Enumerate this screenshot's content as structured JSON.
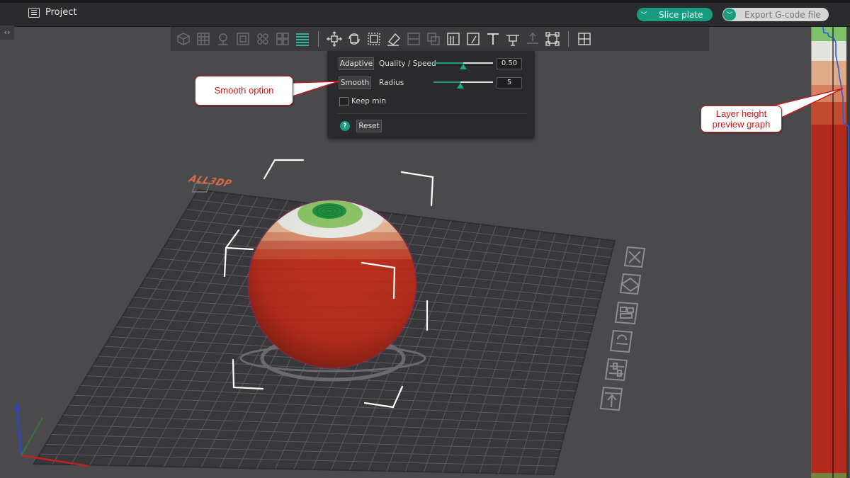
{
  "topbar": {
    "project_label": "Project",
    "slice_button": "Slice plate",
    "export_button": "Export G-code file",
    "collapse_glyph": "‹›"
  },
  "toolbar": {
    "icons": [
      "add-cube-icon",
      "grid-icon",
      "auto-orient-icon",
      "arrange-icon",
      "split-icon",
      "layers-icon",
      "move-icon",
      "rotate-icon",
      "scale-icon",
      "paint-icon",
      "cut-icon",
      "boolean-icon",
      "support-paint-icon",
      "seam-paint-icon",
      "text-icon",
      "measure-icon",
      "assembly-icon",
      "bounding-box-icon",
      "variable-layer-icon"
    ]
  },
  "layer_panel": {
    "adaptive_button": "Adaptive",
    "quality_label": "Quality / Speed",
    "quality_value": "0.50",
    "quality_fraction": 0.5,
    "smooth_button": "Smooth",
    "radius_label": "Radius",
    "radius_value": "5",
    "radius_fraction": 0.45,
    "keep_min_label": "Keep min",
    "keep_min_checked": false,
    "help_glyph": "?",
    "reset_button": "Reset"
  },
  "annotations": {
    "smooth_option": "Smooth option",
    "layer_graph_line1": "Layer height",
    "layer_graph_line2": "preview graph"
  },
  "plate": {
    "brand_label": "ALL3DP"
  },
  "colors": {
    "accent": "#179c80",
    "callout_red": "#c51d1d",
    "brand_orange": "#e06a44"
  }
}
